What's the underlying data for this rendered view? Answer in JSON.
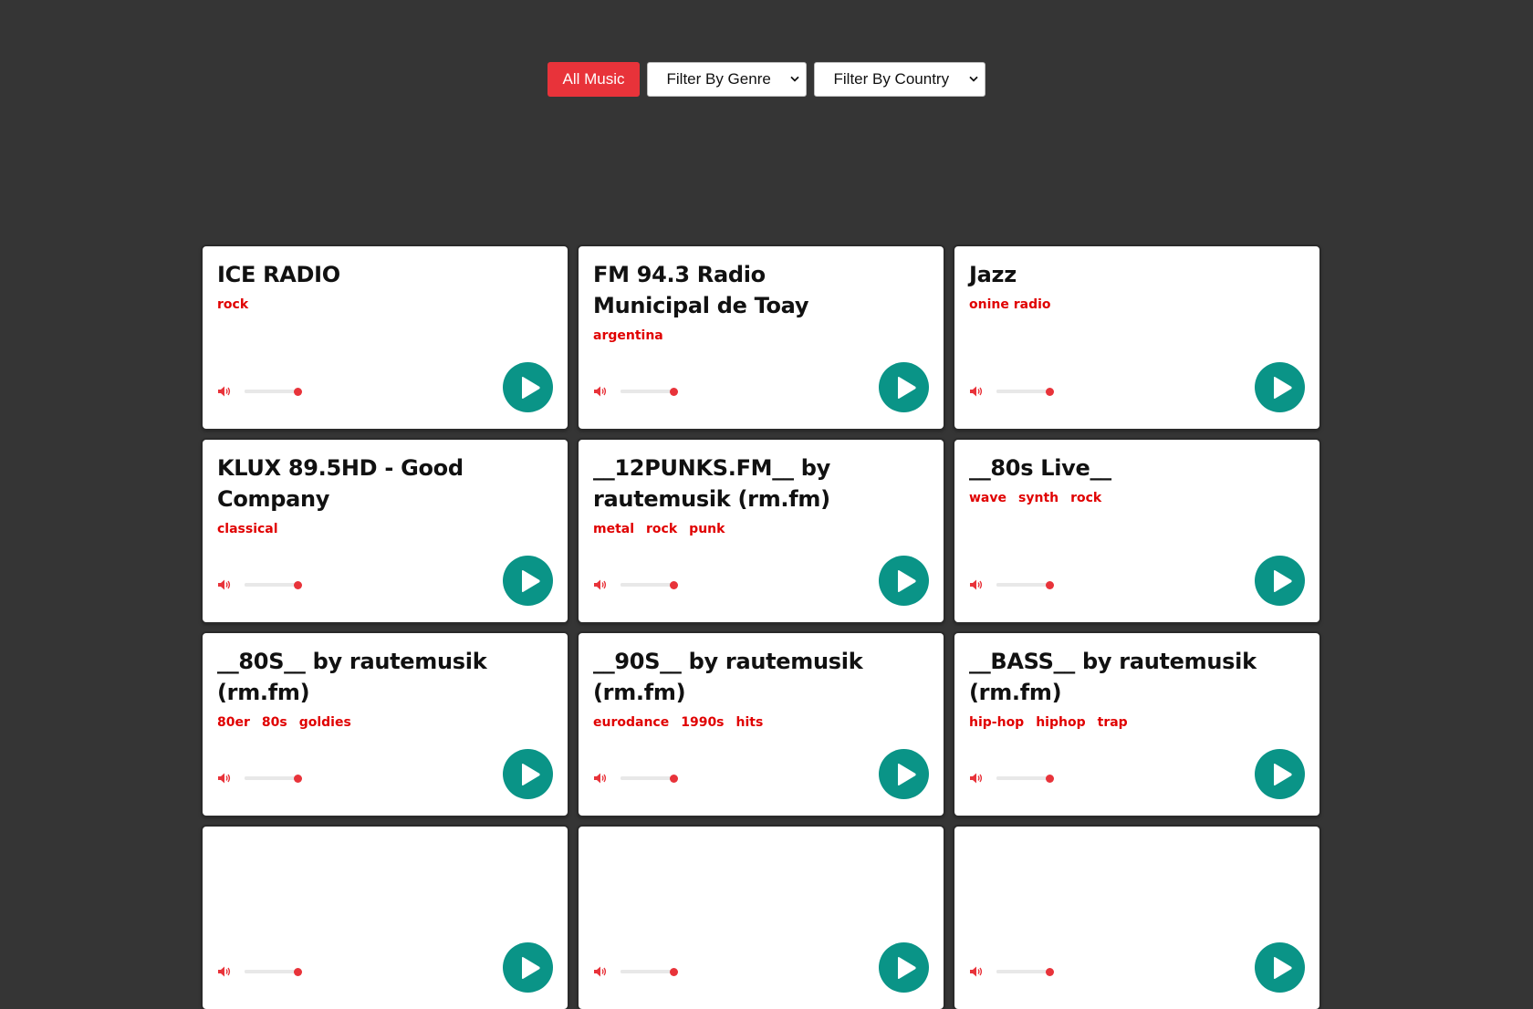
{
  "filters": {
    "all_music_label": "All Music",
    "genre_label": "Filter By Genre",
    "country_label": "Filter By Country"
  },
  "colors": {
    "accent": "#e8333a",
    "play": "#0a9487",
    "tag": "#e00000",
    "background": "#353535"
  },
  "stations": [
    {
      "name": "ICE RADIO",
      "tags": [
        "rock"
      ],
      "volume": 1.0
    },
    {
      "name": "FM 94.3 Radio Municipal de Toay",
      "tags": [
        "argentina"
      ],
      "volume": 1.0
    },
    {
      "name": "Jazz",
      "tags": [
        "onine radio"
      ],
      "volume": 1.0
    },
    {
      "name": "KLUX 89.5HD - Good Company",
      "tags": [
        "classical"
      ],
      "volume": 1.0
    },
    {
      "name": "__12PUNKS.FM__ by rautemusik (rm.fm)",
      "tags": [
        "metal",
        "rock",
        "punk"
      ],
      "volume": 1.0
    },
    {
      "name": "__80s Live__",
      "tags": [
        "wave",
        "synth",
        "rock"
      ],
      "volume": 1.0
    },
    {
      "name": "__80S__ by rautemusik (rm.fm)",
      "tags": [
        "80er",
        "80s",
        "goldies"
      ],
      "volume": 1.0
    },
    {
      "name": "__90S__ by rautemusik (rm.fm)",
      "tags": [
        "eurodance",
        "1990s",
        "hits"
      ],
      "volume": 1.0
    },
    {
      "name": "__BASS__ by rautemusik (rm.fm)",
      "tags": [
        "hip-hop",
        "hiphop",
        "trap"
      ],
      "volume": 1.0
    },
    {
      "name": "",
      "tags": [],
      "volume": 1.0
    },
    {
      "name": "",
      "tags": [],
      "volume": 1.0
    },
    {
      "name": "",
      "tags": [],
      "volume": 1.0
    }
  ],
  "icons": {
    "volume": "volume-icon",
    "play": "play-icon",
    "dropdown": "chevron-down-icon"
  }
}
